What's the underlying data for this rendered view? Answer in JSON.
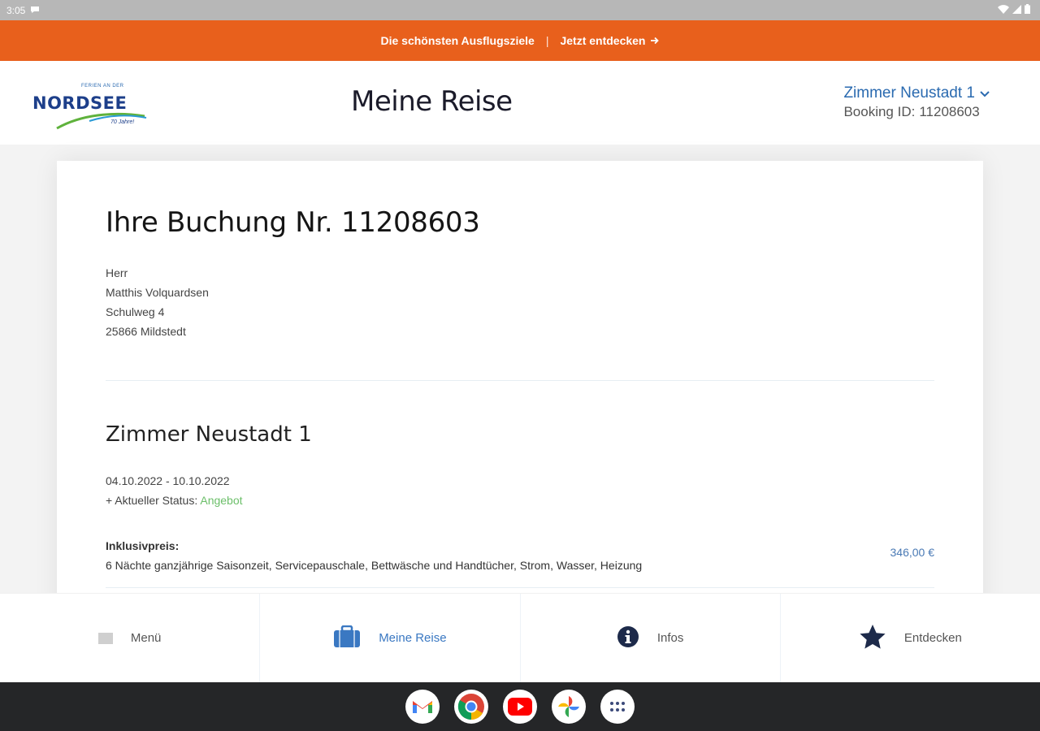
{
  "status_bar": {
    "time": "3:05"
  },
  "promo": {
    "text": "Die schönsten Ausflugsziele",
    "separator": "|",
    "link": "Jetzt entdecken"
  },
  "header": {
    "logo": {
      "word": "NORDSEE",
      "small": "FERIEN AN DER",
      "tag": "70 Jahre!"
    },
    "title": "Meine Reise",
    "room_select": "Zimmer Neustadt 1",
    "booking_id_label": "Booking ID:",
    "booking_id": "11208603"
  },
  "booking": {
    "heading": "Ihre Buchung Nr. 11208603",
    "address": [
      "Herr",
      "Matthis Volquardsen",
      "Schulweg 4",
      "25866 Mildstedt"
    ],
    "room_title": "Zimmer Neustadt 1",
    "dates": "04.10.2022 - 10.10.2022",
    "status_label": "+ Aktueller Status:",
    "status_value": "Angebot",
    "inclusive_label": "Inklusivpreis:",
    "inclusive_text": "6 Nächte ganzjährige Saisonzeit, Servicepauschale, Bettwäsche und Handtücher, Strom, Wasser, Heizung",
    "price": "346,00 €"
  },
  "bottom_nav": [
    {
      "label": "Menü",
      "icon": "menu-icon"
    },
    {
      "label": "Meine Reise",
      "icon": "suitcase-icon",
      "active": true
    },
    {
      "label": "Infos",
      "icon": "info-icon"
    },
    {
      "label": "Entdecken",
      "icon": "star-icon"
    }
  ],
  "taskbar": [
    "gmail-icon",
    "chrome-icon",
    "youtube-icon",
    "photos-icon",
    "app-launcher-icon"
  ],
  "colors": {
    "accent_orange": "#e8601c",
    "link_blue": "#2a6ab0",
    "status_green": "#6cbf6a",
    "nav_dark": "#1d2a4a"
  }
}
